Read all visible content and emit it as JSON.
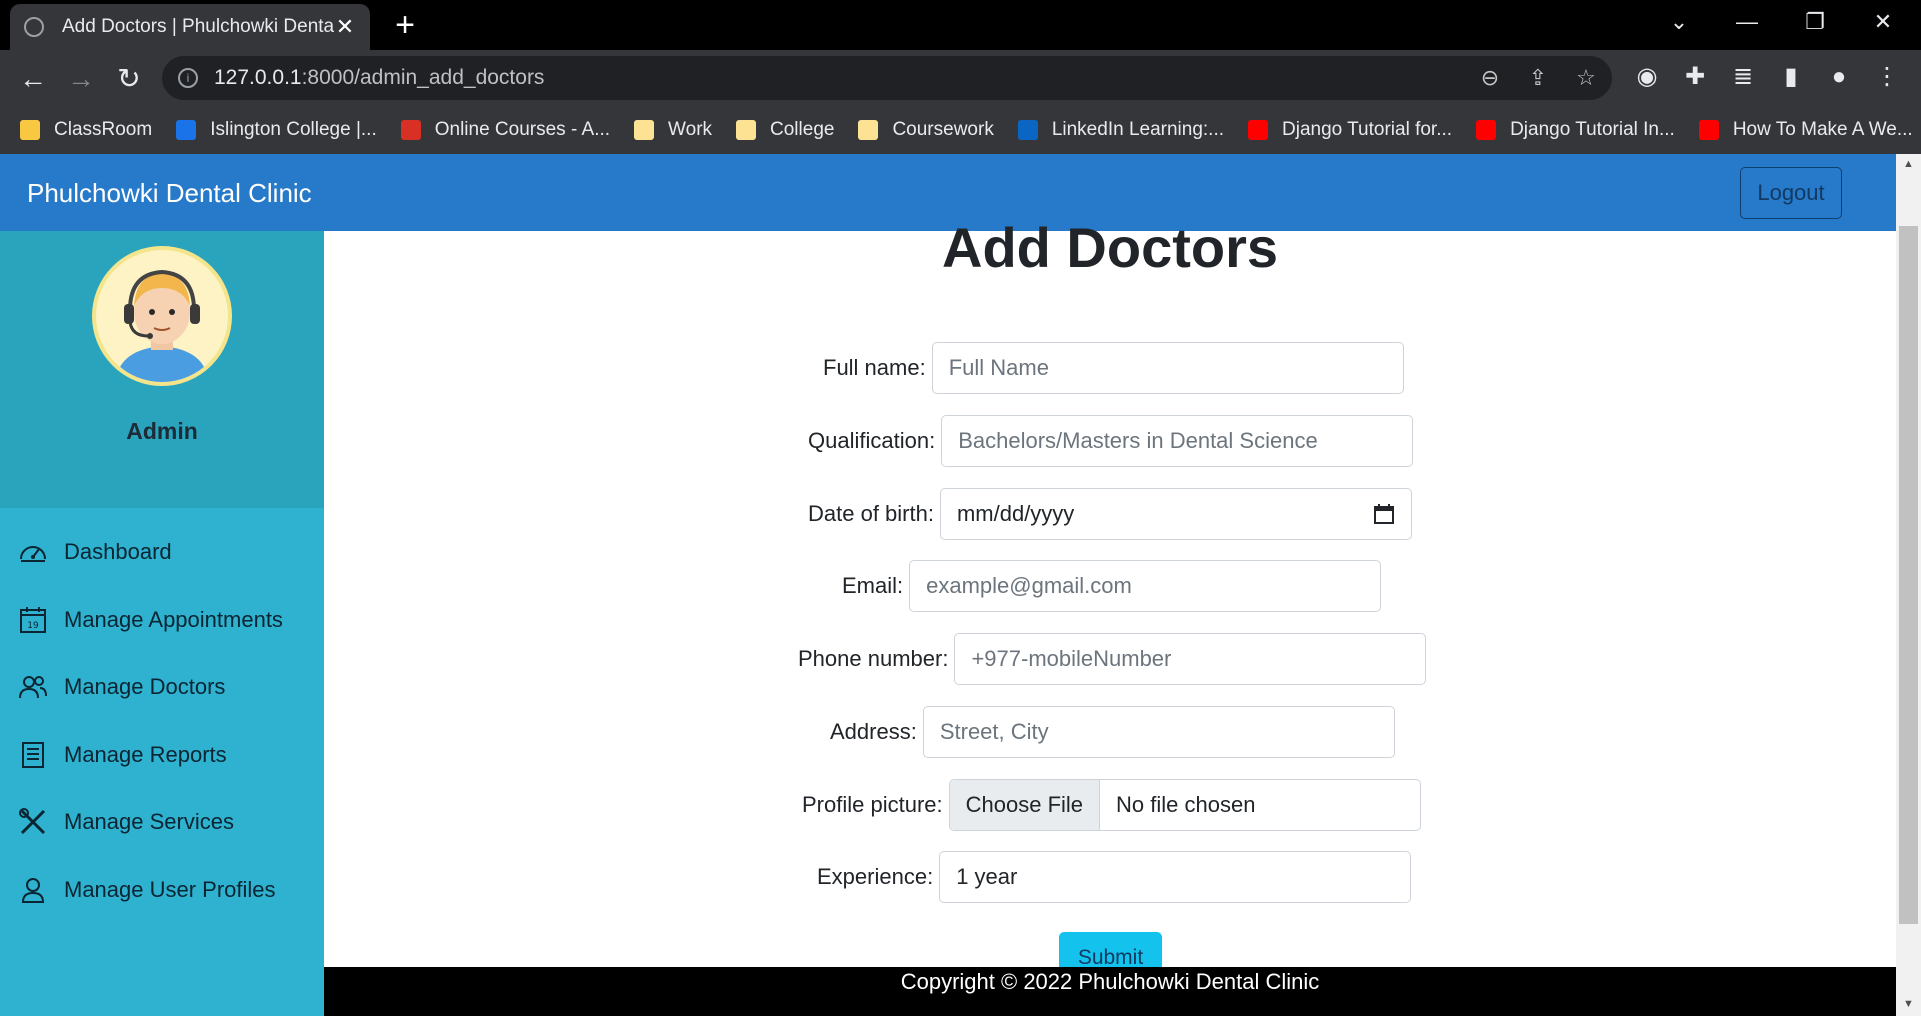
{
  "browser": {
    "tab_title": "Add Doctors | Phulchowki Dental",
    "tab_close": "✕",
    "new_tab": "+",
    "url_host": "127.0.0.1",
    "url_path": ":8000/admin_add_doctors",
    "bookmarks": [
      {
        "label": "ClassRoom",
        "color": "#f9c842"
      },
      {
        "label": "Islington College |...",
        "color": "#1a73e8"
      },
      {
        "label": "Online Courses - A...",
        "color": "#d93025"
      },
      {
        "label": "Work",
        "color": "#fde293"
      },
      {
        "label": "College",
        "color": "#fde293"
      },
      {
        "label": "Coursework",
        "color": "#fde293"
      },
      {
        "label": "LinkedIn Learning:...",
        "color": "#0a66c2"
      },
      {
        "label": "Django Tutorial for...",
        "color": "#ff0000"
      },
      {
        "label": "Django Tutorial In...",
        "color": "#ff0000"
      },
      {
        "label": "How To Make A We...",
        "color": "#ff0000"
      }
    ]
  },
  "navbar": {
    "brand": "Phulchowki Dental Clinic",
    "logout": "Logout"
  },
  "sidebar": {
    "admin_name": "Admin",
    "items": [
      {
        "label": "Dashboard",
        "icon": "dashboard-icon"
      },
      {
        "label": "Manage Appointments",
        "icon": "calendar-icon"
      },
      {
        "label": "Manage Doctors",
        "icon": "users-icon"
      },
      {
        "label": "Manage Reports",
        "icon": "report-icon"
      },
      {
        "label": "Manage Services",
        "icon": "tools-icon"
      },
      {
        "label": "Manage User Profiles",
        "icon": "user-icon"
      }
    ]
  },
  "form": {
    "heading": "Add Doctors",
    "full_name": {
      "label": "Full name:",
      "placeholder": "Full Name"
    },
    "qualification": {
      "label": "Qualification:",
      "placeholder": "Bachelors/Masters in Dental Science"
    },
    "dob": {
      "label": "Date of birth:",
      "value": "mm/dd/yyyy"
    },
    "email": {
      "label": "Email:",
      "placeholder": "example@gmail.com"
    },
    "phone": {
      "label": "Phone number:",
      "placeholder": "+977-mobileNumber"
    },
    "address": {
      "label": "Address:",
      "placeholder": "Street, City"
    },
    "picture": {
      "label": "Profile picture:",
      "button": "Choose File",
      "status": "No file chosen"
    },
    "experience": {
      "label": "Experience:",
      "value": "1 year"
    },
    "submit": "Submit"
  },
  "footer": {
    "copyright": "Copyright © 2022 Phulchowki Dental Clinic"
  }
}
